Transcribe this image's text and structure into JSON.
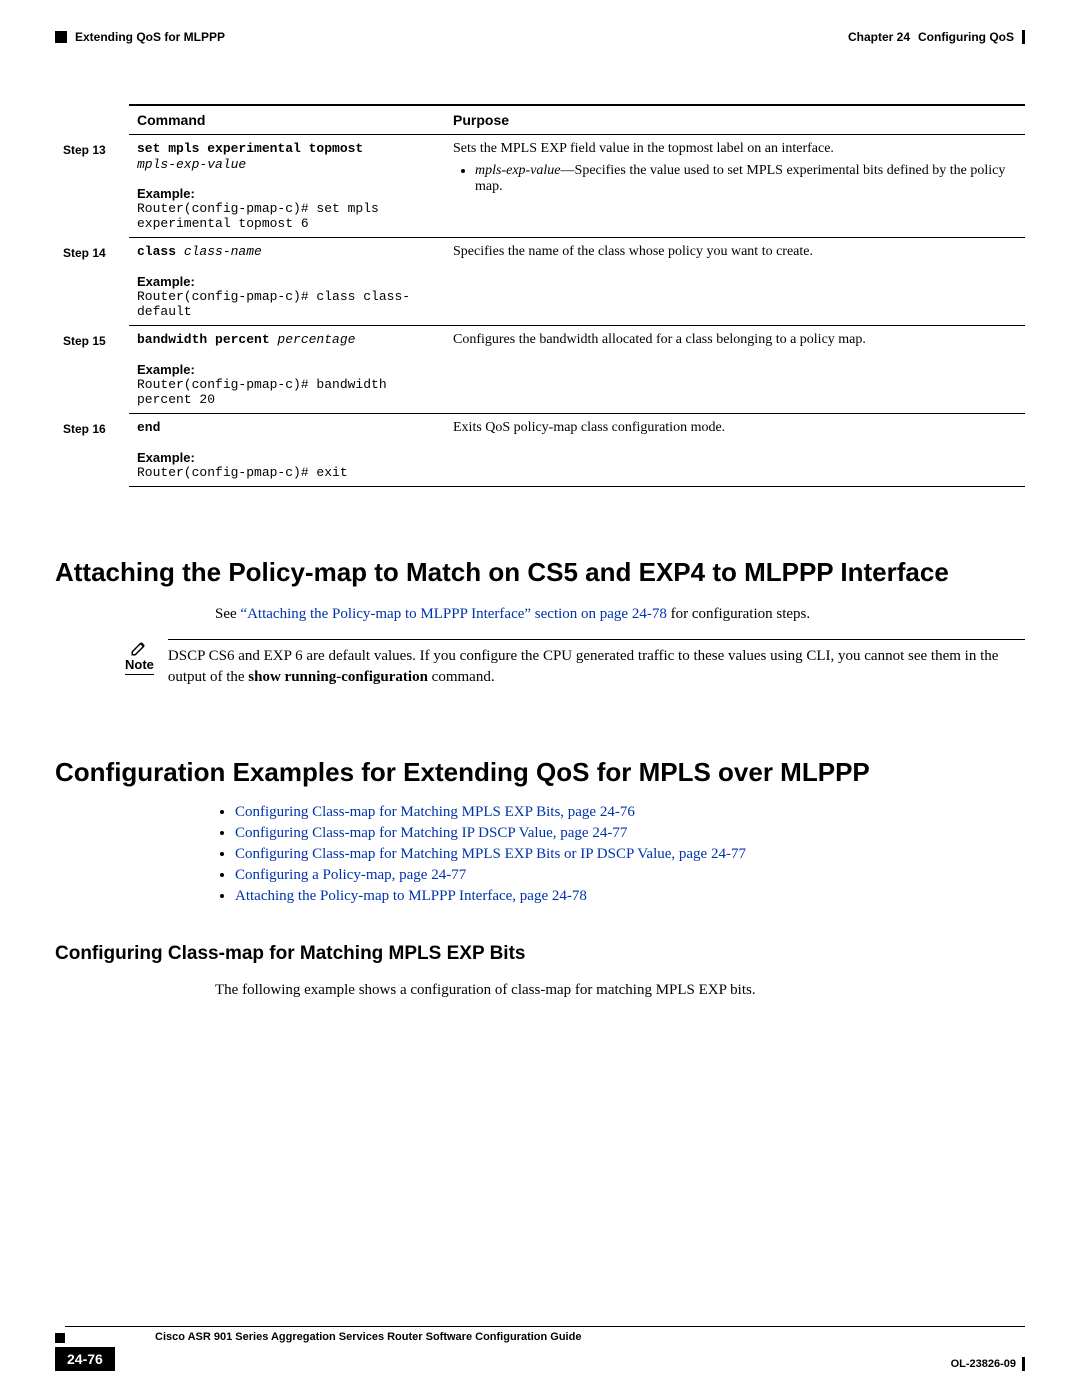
{
  "header": {
    "left": "Extending QoS for MLPPP",
    "chapter_label": "Chapter 24",
    "chapter_title": "Configuring QoS"
  },
  "table": {
    "head_command": "Command",
    "head_purpose": "Purpose",
    "rows": [
      {
        "step": "Step 13",
        "cmd_bold": "set mpls experimental topmost",
        "cmd_ital": "mpls-exp-value",
        "example_label": "Example:",
        "example_text": "Router(config-pmap-c)# set mpls experimental topmost 6",
        "purpose_intro": "Sets the MPLS EXP field value in the topmost label on an interface.",
        "bullet_ital": "mpls-exp-value",
        "bullet_rest": "—Specifies the value used to set MPLS experimental bits defined by the policy map."
      },
      {
        "step": "Step 14",
        "cmd_bold": "class",
        "cmd_ital": " class-name",
        "example_label": "Example:",
        "example_text": "Router(config-pmap-c)# class class-default",
        "purpose_intro": "Specifies the name of the class whose policy you want to create."
      },
      {
        "step": "Step 15",
        "cmd_bold": "bandwidth percent",
        "cmd_ital": " percentage",
        "example_label": "Example:",
        "example_text": "Router(config-pmap-c)# bandwidth percent 20",
        "purpose_intro": "Configures the bandwidth allocated for a class belonging to a policy map."
      },
      {
        "step": "Step 16",
        "cmd_bold": "end",
        "cmd_ital": "",
        "example_label": "Example:",
        "example_text": "Router(config-pmap-c)# exit",
        "purpose_intro": "Exits QoS policy-map class configuration mode."
      }
    ]
  },
  "section1": {
    "title": "Attaching the Policy-map to Match on CS5 and EXP4 to MLPPP Interface",
    "see_prefix": "See ",
    "see_link": "“Attaching the Policy-map to MLPPP Interface” section on page 24-78",
    "see_suffix": " for configuration steps.",
    "note_label": "Note",
    "note_text_1": "DSCP CS6 and EXP 6 are default values. If you configure the CPU generated traffic to these values using CLI, you cannot see them in the output of the ",
    "note_bold": "show running-configuration",
    "note_text_2": " command."
  },
  "section2": {
    "title": "Configuration Examples for Extending QoS for MPLS over MLPPP",
    "links": [
      "Configuring Class-map for Matching MPLS EXP Bits, page 24-76",
      "Configuring Class-map for Matching IP DSCP Value, page 24-77",
      "Configuring Class-map for Matching MPLS EXP Bits or IP DSCP Value, page 24-77",
      "Configuring a Policy-map, page 24-77",
      "Attaching the Policy-map to MLPPP Interface, page 24-78"
    ]
  },
  "subsection": {
    "title": "Configuring Class-map for Matching MPLS EXP Bits",
    "body": "The following example shows a configuration of class-map for matching MPLS EXP bits."
  },
  "footer": {
    "guide": "Cisco ASR 901 Series Aggregation Services Router Software Configuration Guide",
    "page_num": "24-76",
    "ol_num": "OL-23826-09"
  }
}
